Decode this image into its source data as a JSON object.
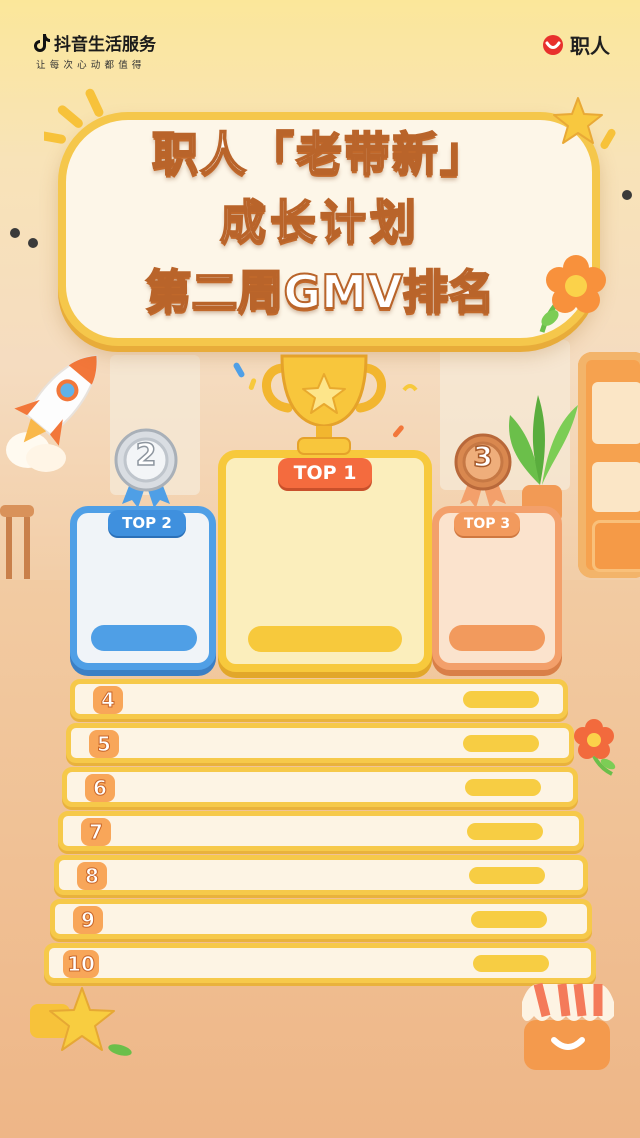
{
  "header": {
    "brand_name": "抖音生活服务",
    "brand_slogan": "让每次心动都值得",
    "partner_logo": "职人"
  },
  "title": {
    "line1": "职人「老带新」",
    "line2": "成长计划",
    "line3": "第二周GMV排名"
  },
  "podium": [
    {
      "label": "TOP 1",
      "medal": "trophy-icon",
      "color": "#f7c93c"
    },
    {
      "label": "TOP 2",
      "medal_number": "2",
      "color": "#4f9fe6"
    },
    {
      "label": "TOP 3",
      "medal_number": "3",
      "color": "#f3a06b"
    }
  ],
  "ranking": [
    {
      "rank": "4"
    },
    {
      "rank": "5"
    },
    {
      "rank": "6"
    },
    {
      "rank": "7"
    },
    {
      "rank": "8"
    },
    {
      "rank": "9"
    },
    {
      "rank": "10"
    }
  ],
  "colors": {
    "frame": "#f6c94a",
    "title_outline": "#b9642a",
    "blue": "#4f9fe6",
    "orange": "#f3a06b"
  }
}
